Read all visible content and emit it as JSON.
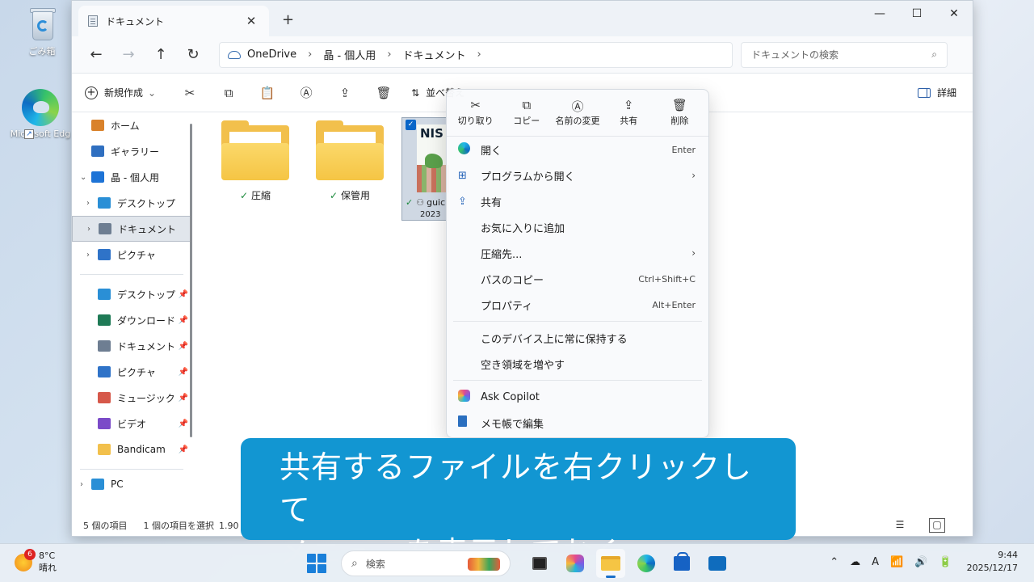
{
  "desktop": {
    "recycle_bin_label": "ごみ箱",
    "edge_label": "Microsoft Edg"
  },
  "window": {
    "tab_title": "ドキュメント",
    "tab_close": "✕",
    "new_tab": "+",
    "minimize": "—",
    "maximize": "☐",
    "close": "✕"
  },
  "address": {
    "back": "←",
    "forward": "→",
    "up": "↑",
    "refresh": "↻",
    "crumbs": [
      "OneDrive",
      "晶 - 個人用",
      "ドキュメント"
    ],
    "crumb_sep": "›",
    "search_placeholder": "ドキュメントの検索",
    "search_icon": "⌕"
  },
  "toolbar": {
    "new_label": "新規作成",
    "new_chevron": "⌄",
    "sort_label": "並べ替え",
    "detail_label": "詳細",
    "icons": {
      "cut": "✂",
      "copy": "⧉",
      "paste": "📋",
      "rename": "Ⓐ",
      "share": "⇪",
      "delete": "🗑",
      "sort": "⇅"
    }
  },
  "sidebar": {
    "top": [
      {
        "label": "ホーム",
        "icon": "home-icon",
        "color": "#d9822b",
        "chev": ""
      },
      {
        "label": "ギャラリー",
        "icon": "gallery-icon",
        "color": "#2f6fc0",
        "chev": ""
      },
      {
        "label": "晶 - 個人用",
        "icon": "onedrive-icon",
        "color": "#1d73d6",
        "chev": "⌄"
      },
      {
        "label": "デスクトップ",
        "icon": "desktop-icon",
        "color": "#2a8fd6",
        "chev": "›"
      },
      {
        "label": "ドキュメント",
        "icon": "document-icon",
        "color": "#6e7e92",
        "chev": "›"
      },
      {
        "label": "ピクチャ",
        "icon": "picture-icon",
        "color": "#2f73c8",
        "chev": "›"
      }
    ],
    "pinned": [
      {
        "label": "デスクトップ",
        "icon": "desktop-icon",
        "color": "#2a8fd6"
      },
      {
        "label": "ダウンロード",
        "icon": "download-icon",
        "color": "#1f7a56"
      },
      {
        "label": "ドキュメント",
        "icon": "document-icon",
        "color": "#6e7e92"
      },
      {
        "label": "ピクチャ",
        "icon": "picture-icon",
        "color": "#2f73c8"
      },
      {
        "label": "ミュージック",
        "icon": "music-icon",
        "color": "#d6584a"
      },
      {
        "label": "ビデオ",
        "icon": "video-icon",
        "color": "#7b4bc8"
      },
      {
        "label": "Bandicam",
        "icon": "folder-icon",
        "color": "#f2c04c"
      }
    ],
    "pin_glyph": "📌",
    "pc_label": "PC"
  },
  "files": [
    {
      "name": "圧縮",
      "status": "✓"
    },
    {
      "name": "保管用",
      "status": "✓"
    }
  ],
  "selected_file": {
    "check": "✓",
    "thumb_text": "NIS",
    "name": "guic",
    "date": "2023"
  },
  "statusbar": {
    "item_count": "5 個の項目",
    "selected": "1 個の項目を選択",
    "size": "1.90"
  },
  "context_menu": {
    "quick": [
      {
        "label": "切り取り",
        "icon": "✂"
      },
      {
        "label": "コピー",
        "icon": "⧉"
      },
      {
        "label": "名前の変更",
        "icon": "Ⓐ"
      },
      {
        "label": "共有",
        "icon": "⇪"
      },
      {
        "label": "削除",
        "icon": "🗑"
      }
    ],
    "items": [
      {
        "label": "開く",
        "shortcut": "Enter",
        "icon": "edge-icon"
      },
      {
        "label": "プログラムから開く",
        "shortcut": "",
        "icon": "open-with-icon",
        "arrow": "›"
      },
      {
        "label": "共有",
        "shortcut": "",
        "icon": "share-icon"
      },
      {
        "label": "お気に入りに追加",
        "shortcut": ""
      },
      {
        "label": "圧縮先...",
        "shortcut": "",
        "arrow": "›"
      },
      {
        "label": "パスのコピー",
        "shortcut": "Ctrl+Shift+C"
      },
      {
        "label": "プロパティ",
        "shortcut": "Alt+Enter"
      }
    ],
    "items2": [
      {
        "label": "このデバイス上に常に保持する"
      },
      {
        "label": "空き領域を増やす"
      }
    ],
    "items3": [
      {
        "label": "Ask Copilot",
        "icon": "copilot-icon"
      },
      {
        "label": "メモ帳で編集",
        "icon": "notepad-icon"
      }
    ]
  },
  "caption": {
    "line1": "共有するファイルを右クリックして",
    "line2": "メニューを表示しておく"
  },
  "taskbar": {
    "temp": "8°C",
    "weather": "晴れ",
    "weather_badge": "6",
    "search_label": "検索",
    "time": "9:44",
    "date": "2025/12/17",
    "tray_icons": [
      "⌃",
      "☁",
      "A",
      "📶",
      "🔊",
      "🔋"
    ]
  }
}
